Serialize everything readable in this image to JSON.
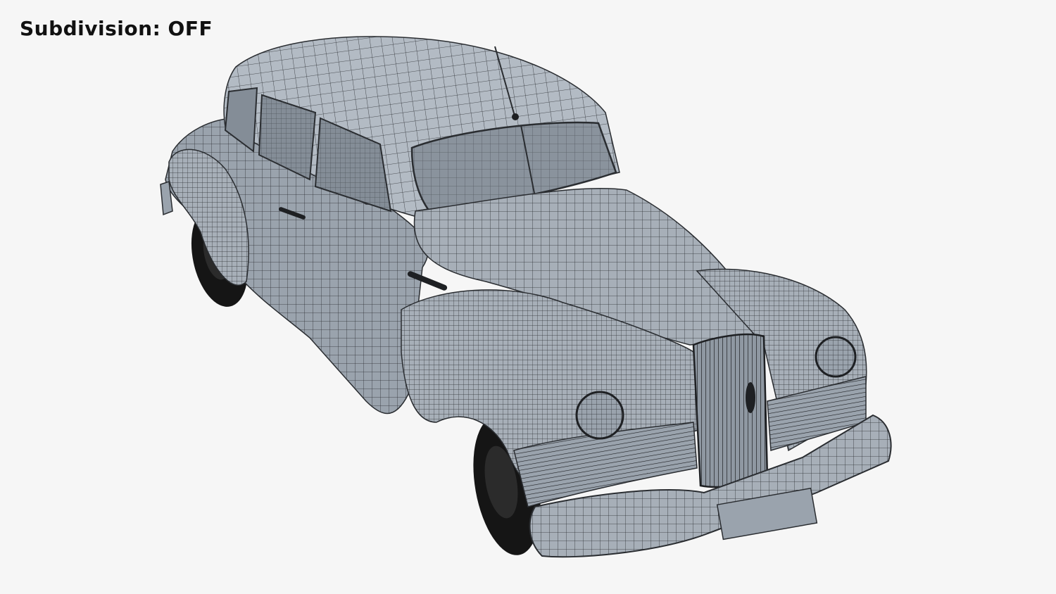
{
  "caption": "Subdivision: OFF",
  "colors": {
    "background": "#f6f6f6",
    "body": "#9aa3ad",
    "body_light": "#b3bbc4",
    "glass": "#848d97",
    "wire": "#2a2d31",
    "tire": "#151515",
    "caption_text": "#111111"
  }
}
